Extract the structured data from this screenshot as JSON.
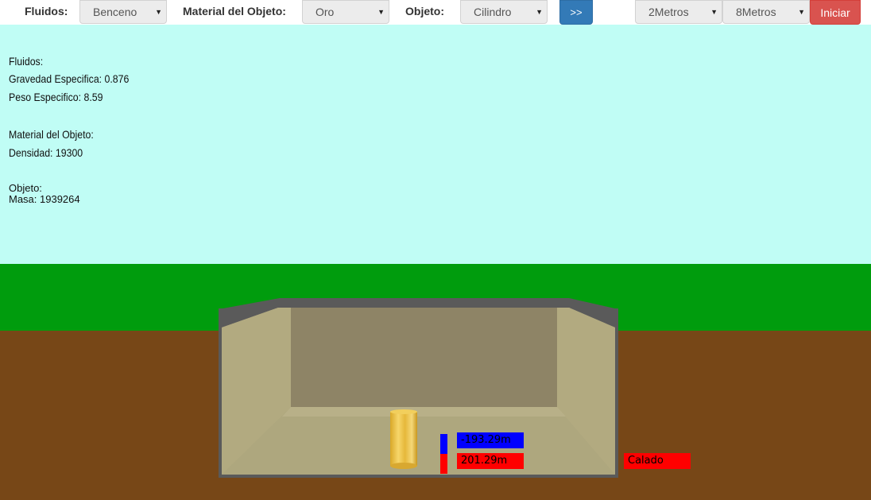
{
  "toolbar": {
    "fluid_label": "Fluidos:",
    "fluid_value": "Benceno",
    "material_label": "Material del Objeto:",
    "material_value": "Oro",
    "object_label": "Objeto:",
    "object_value": "Cilindro",
    "next_label": ">>",
    "size1_value": "2Metros",
    "size2_value": "8Metros",
    "start_label": "Iniciar"
  },
  "info": {
    "fluid_heading": "Fluidos:",
    "specific_gravity": "Gravedad Especifica: 0.876",
    "specific_weight": "Peso Especifico: 8.59",
    "material_heading": "Material del Objeto:",
    "density": "Densidad: 19300",
    "object_heading": "Objeto:",
    "mass": "Masa: 1939264"
  },
  "readouts": {
    "upper": "-193.29m",
    "lower": "201.29m",
    "draft": "Calado"
  },
  "colors": {
    "sky": "#c0fdf5",
    "grass": "#009c0d",
    "soil": "#774717",
    "tank_wall": "#5a5a5a",
    "fluid": "#aea77e",
    "readout_blue": "#0000ff",
    "readout_red": "#ff0000"
  }
}
